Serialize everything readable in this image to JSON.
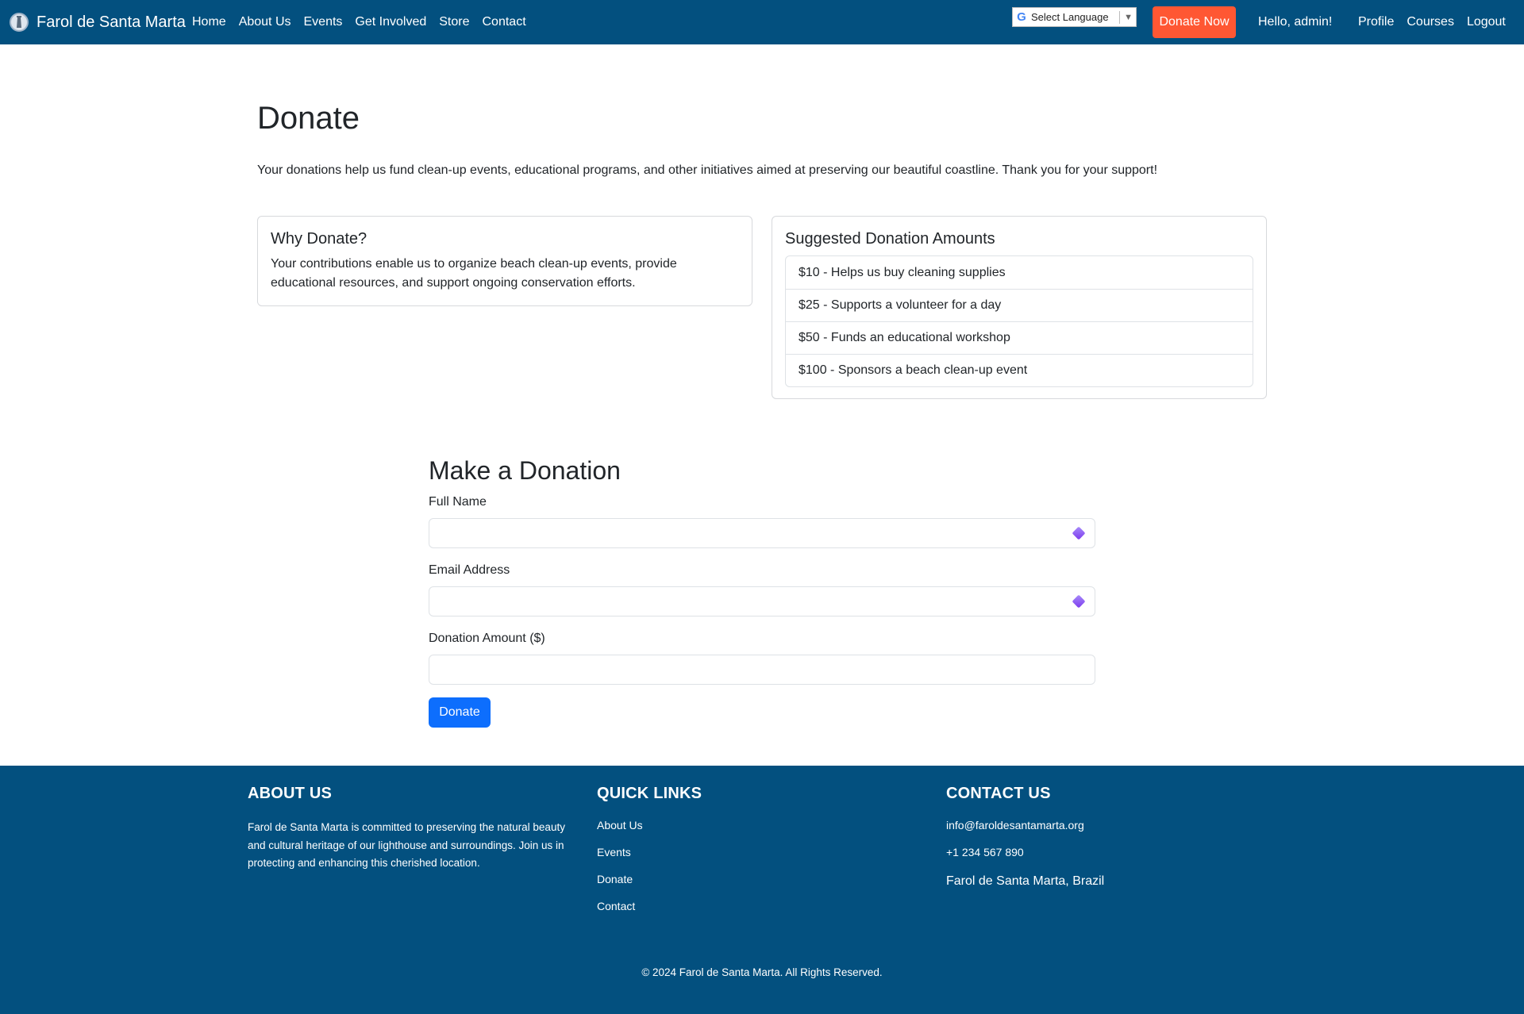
{
  "nav": {
    "brand": "Farol de Santa Marta",
    "links": [
      "Home",
      "About Us",
      "Events",
      "Get Involved",
      "Store",
      "Contact"
    ],
    "language": "Select Language",
    "donate_now": "Donate Now",
    "greeting": "Hello, admin!",
    "user_links": [
      "Profile",
      "Courses",
      "Logout"
    ]
  },
  "header": {
    "title": "Donate",
    "lead": "Your donations help us fund clean-up events, educational programs, and other initiatives aimed at preserving our beautiful coastline. Thank you for your support!"
  },
  "why": {
    "title": "Why Donate?",
    "text": "Your contributions enable us to organize beach clean-up events, provide educational resources, and support ongoing conservation efforts."
  },
  "amounts": {
    "title": "Suggested Donation Amounts",
    "items": [
      "$10 - Helps us buy cleaning supplies",
      "$25 - Supports a volunteer for a day",
      "$50 - Funds an educational workshop",
      "$100 - Sponsors a beach clean-up event"
    ]
  },
  "form": {
    "title": "Make a Donation",
    "name_label": "Full Name",
    "name_value": "",
    "email_label": "Email Address",
    "email_value": "",
    "amount_label": "Donation Amount ($)",
    "amount_value": "",
    "submit": "Donate"
  },
  "footer": {
    "about_title": "ABOUT US",
    "about_text": "Farol de Santa Marta is committed to preserving the natural beauty and cultural heritage of our lighthouse and surroundings. Join us in protecting and enhancing this cherished location.",
    "links_title": "QUICK LINKS",
    "links": [
      "About Us",
      "Events",
      "Donate",
      "Contact"
    ],
    "contact_title": "CONTACT US",
    "email": "info@faroldesantamarta.org",
    "phone": "+1 234 567 890",
    "location": "Farol de Santa Marta, Brazil",
    "copyright": "© 2024 Farol de Santa Marta. All Rights Reserved."
  },
  "colors": {
    "navbar": "#03507f",
    "donate_now": "#ff5733",
    "primary_button": "#0d6efd"
  }
}
